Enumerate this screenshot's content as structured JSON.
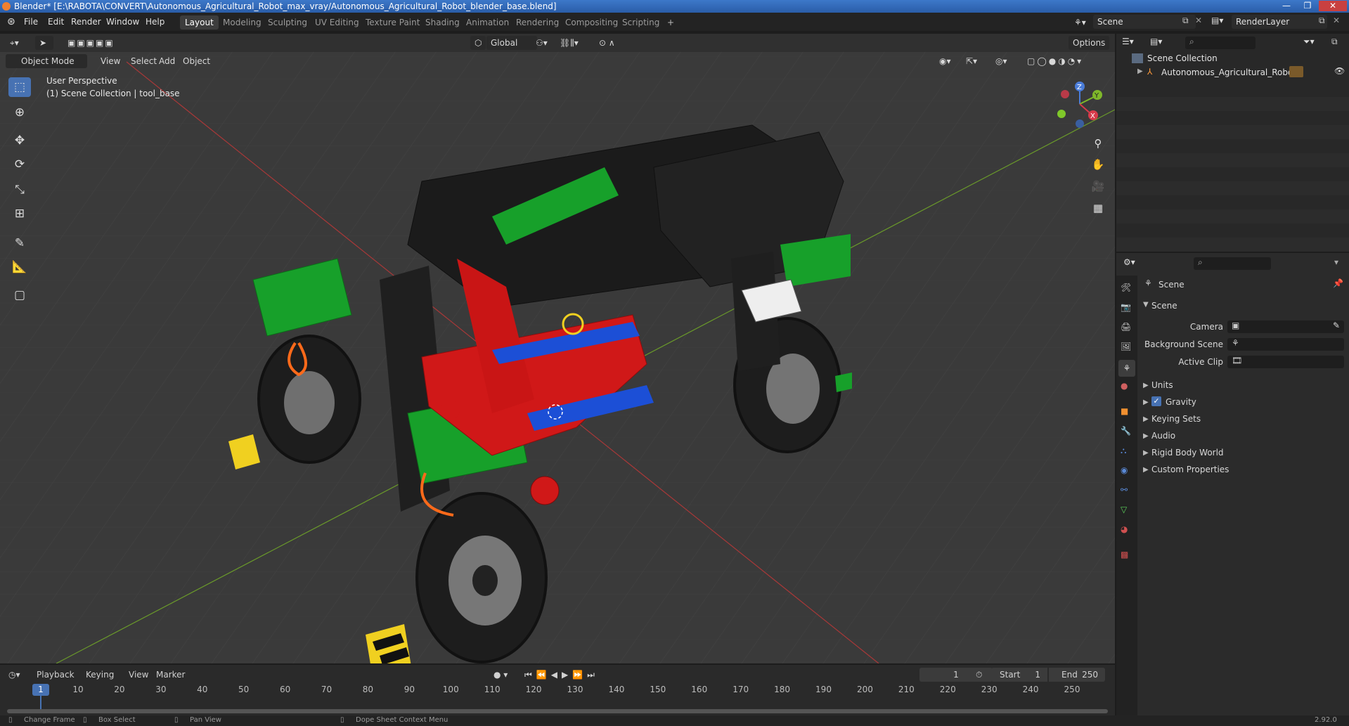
{
  "title_bar": {
    "text": "Blender* [E:\\RABOTA\\CONVERT\\Autonomous_Agricultural_Robot_max_vray/Autonomous_Agricultural_Robot_blender_base.blend]"
  },
  "menu": [
    "File",
    "Edit",
    "Render",
    "Window",
    "Help"
  ],
  "workspaces": [
    "Layout",
    "Modeling",
    "Sculpting",
    "UV Editing",
    "Texture Paint",
    "Shading",
    "Animation",
    "Rendering",
    "Compositing",
    "Scripting"
  ],
  "active_workspace": "Layout",
  "scene_field": "Scene",
  "view_layer_field": "RenderLayer",
  "viewport": {
    "mode": "Object Mode",
    "header_menu": [
      "View",
      "Select",
      "Add",
      "Object"
    ],
    "orientation": "Global",
    "options": "Options",
    "overlay_line1": "User Perspective",
    "overlay_line2": "(1) Scene Collection | tool_base",
    "gizmo": {
      "z": "Z",
      "y": "Y",
      "x": "X"
    }
  },
  "outliner": {
    "root": "Scene Collection",
    "items": [
      "Autonomous_Agricultural_Robot"
    ]
  },
  "properties": {
    "header": "Scene",
    "panel": "Scene",
    "fields": [
      {
        "label": "Camera"
      },
      {
        "label": "Background Scene"
      },
      {
        "label": "Active Clip"
      }
    ],
    "subpanels": [
      "Units",
      "Gravity",
      "Keying Sets",
      "Audio",
      "Rigid Body World",
      "Custom Properties"
    ],
    "gravity_checked": true
  },
  "timeline": {
    "menus": [
      "Playback",
      "Keying",
      "View",
      "Marker"
    ],
    "current_frame": "1",
    "start_label": "Start",
    "start": "1",
    "end_label": "End",
    "end": "250",
    "ticks": [
      "1",
      "10",
      "20",
      "30",
      "40",
      "50",
      "60",
      "70",
      "80",
      "90",
      "100",
      "110",
      "120",
      "130",
      "140",
      "150",
      "160",
      "170",
      "180",
      "190",
      "200",
      "210",
      "220",
      "230",
      "240",
      "250"
    ]
  },
  "status_bar": {
    "items": [
      "Change Frame",
      "Box Select",
      "Pan View",
      "Dope Sheet Context Menu"
    ],
    "version": "2.92.0"
  },
  "colors": {
    "accent": "#4772b3",
    "model_green": "#17a02a",
    "model_red": "#d01818",
    "model_blue": "#1c4fd6",
    "model_black": "#1b1b1b"
  }
}
